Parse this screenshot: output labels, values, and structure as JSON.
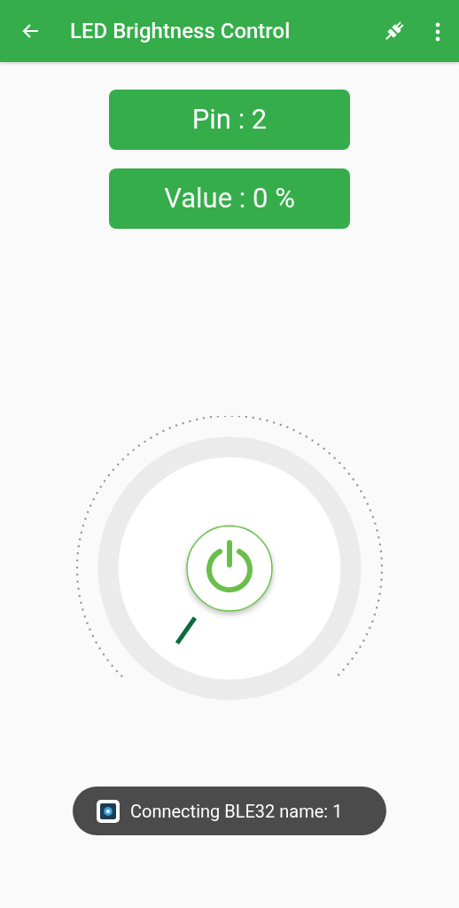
{
  "app_bar": {
    "title": "LED Brightness Control"
  },
  "info": [
    {
      "text": "Pin : 2"
    },
    {
      "text": "Value : 0 %"
    }
  ],
  "toast": {
    "text": "Connecting BLE32 name: 1"
  }
}
